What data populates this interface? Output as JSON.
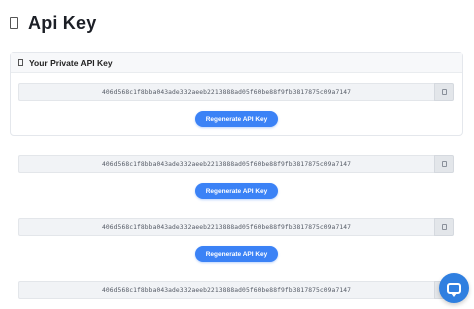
{
  "page": {
    "title": "Api Key",
    "icon": "document-icon"
  },
  "card": {
    "title": "Your Private API Key",
    "icon": "document-icon"
  },
  "keys": [
    "406d568c1f8bba043ade332aeeb2213888ad05f60be88f9fb3817875c09a7147",
    "406d568c1f8bba043ade332aeeb2213888ad05f60be88f9fb3817875c09a7147",
    "406d568c1f8bba043ade332aeeb2213888ad05f60be88f9fb3817875c09a7147",
    "406d568c1f8bba043ade332aeeb2213888ad05f60be88f9fb3817875c09a7147"
  ],
  "buttons": {
    "regenerate_label": "Regenerate API Key",
    "copy_icon": "copy-icon"
  },
  "chat": {
    "icon": "chat-icon"
  },
  "colors": {
    "accent": "#3b82f6",
    "chat": "#2f7fe0",
    "field_bg": "#f1f3f6"
  }
}
